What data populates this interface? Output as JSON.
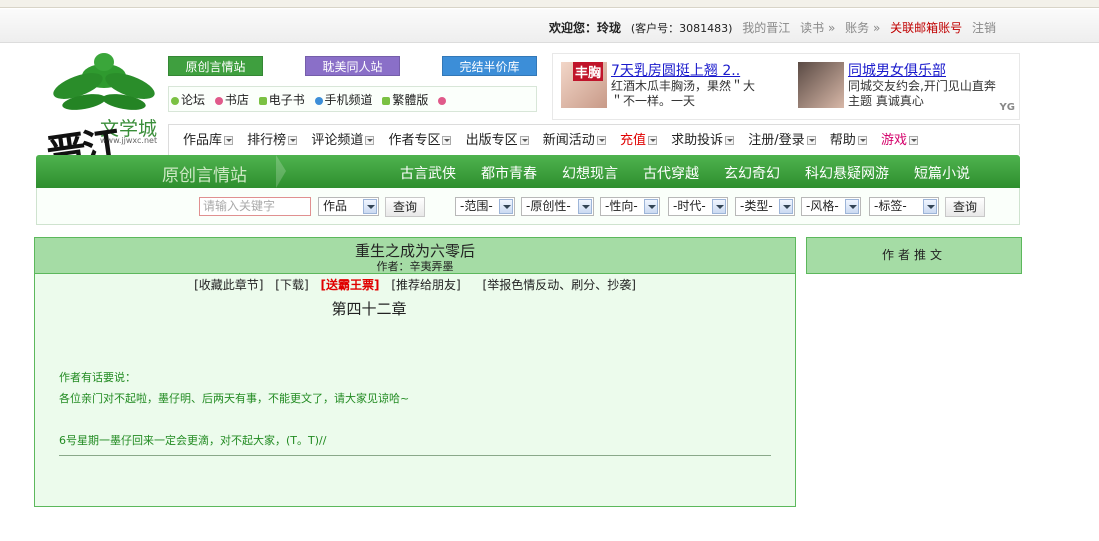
{
  "user_bar": {
    "welcome": "欢迎您：",
    "username": "玲珑",
    "customer_id": "(客户号：3081483)",
    "my_jjwxc": "我的晋江",
    "read_book": "读书 »",
    "account": "账务 »",
    "link_email": "关联邮箱账号",
    "logout": "注销"
  },
  "logo": {
    "site_name": "文学城",
    "url": "www.jjwxc.net",
    "brand": "晋江"
  },
  "channels": [
    {
      "label": "原创言情站",
      "color": "#3f9f3f"
    },
    {
      "label": "耽美同人站",
      "color": "#8a6fc8"
    },
    {
      "label": "完结半价库",
      "color": "#3c8ed8"
    }
  ],
  "quick_links": [
    "论坛",
    "书店",
    "电子书",
    "手机频道",
    "繁體版"
  ],
  "ads": [
    {
      "tag": "丰胸",
      "title": "7天乳房圆挺上翘 2..",
      "desc": "红酒木瓜丰胸汤，果然＂大＂不一样。一天"
    },
    {
      "title": "同城男女俱乐部",
      "desc": "同城交友约会,开门见山直奔主题 真诚真心"
    }
  ],
  "ad_logo": "YG",
  "menu": [
    "作品库",
    "排行榜",
    "评论频道",
    "作者专区",
    "出版专区",
    "新闻活动",
    "充值",
    "求助投诉",
    "注册/登录",
    "帮助",
    "游戏"
  ],
  "green_bar": {
    "current": "原创言情站",
    "categories": [
      "古言武侠",
      "都市青春",
      "幻想现言",
      "古代穿越",
      "玄幻奇幻",
      "科幻悬疑网游",
      "短篇小说"
    ]
  },
  "search": {
    "keyword_placeholder": "请输入关键字",
    "type_value": "作品",
    "search_button": "查询",
    "filters": [
      "-范围-",
      "-原创性-",
      "-性向-",
      "-时代-",
      "-类型-",
      "-风格-",
      "-标签-"
    ],
    "filter_search_button": "查询"
  },
  "book": {
    "title": "重生之成为六零后",
    "author_line": "作者：辛夷弄墨",
    "actions": [
      "[收藏此章节]",
      "[下载]",
      "[送霸王票]",
      "[推荐给朋友]",
      "[举报色情反动、刷分、抄袭]"
    ],
    "chapter": "第四十二章",
    "note_heading": "作者有话要说：",
    "note_line1": "各位亲门对不起啦，墨仔明、后两天有事，不能更文了，请大家见谅哈~",
    "note_line2": "6号星期一墨仔回来一定会更滴，对不起大家，(T。T)//"
  },
  "sidebar": {
    "title": "作者推文"
  }
}
